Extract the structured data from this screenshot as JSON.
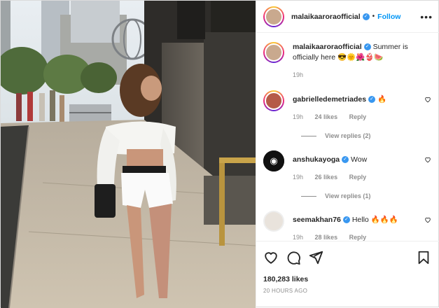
{
  "header": {
    "username": "malaikaaroraofficial",
    "separator": "•",
    "follow_label": "Follow",
    "more_icon": "more-horizontal-icon"
  },
  "caption": {
    "username": "malaikaaroraofficial",
    "text": "Summer is officially here 😎🌞🌺👙🍉",
    "time": "19h"
  },
  "comments": [
    {
      "username": "gabrielledemetriades",
      "text": "🔥",
      "time": "19h",
      "likes": "24 likes",
      "reply": "Reply",
      "view_replies": "View replies (2)"
    },
    {
      "username": "anshukayoga",
      "text": "Wow",
      "time": "19h",
      "likes": "26 likes",
      "reply": "Reply",
      "view_replies": "View replies (1)"
    },
    {
      "username": "seemakhan76",
      "text": "Hello 🔥🔥🔥",
      "time": "19h",
      "likes": "28 likes",
      "reply": "Reply"
    }
  ],
  "actions": {
    "like_icon": "heart-icon",
    "comment_icon": "comment-icon",
    "share_icon": "paper-plane-icon",
    "save_icon": "bookmark-icon"
  },
  "likes_count": "180,283 likes",
  "posted": "20 HOURS AGO",
  "colors": {
    "accent": "#0095f6",
    "verified": "#3897f0",
    "muted": "#8e8e8e",
    "text": "#262626"
  }
}
